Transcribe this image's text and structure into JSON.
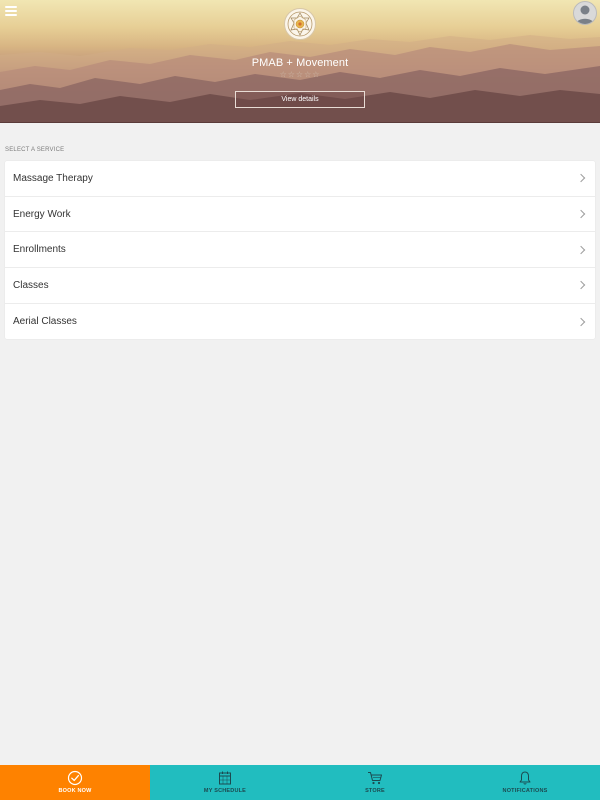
{
  "header": {
    "studio_name": "PMAB + Movement",
    "rating_stars": "☆☆☆☆☆",
    "view_details_label": "View details",
    "menu_icon": "hamburger-menu-icon",
    "avatar_icon": "user-avatar-icon",
    "logo_icon": "mandala-logo-icon"
  },
  "services": {
    "section_label": "SELECT A SERVICE",
    "items": [
      {
        "label": "Massage Therapy"
      },
      {
        "label": "Energy Work"
      },
      {
        "label": "Enrollments"
      },
      {
        "label": "Classes"
      },
      {
        "label": "Aerial Classes"
      }
    ]
  },
  "bottom_nav": {
    "items": [
      {
        "label": "BOOK NOW",
        "icon": "check-circle-icon",
        "active": true
      },
      {
        "label": "MY SCHEDULE",
        "icon": "calendar-icon",
        "active": false
      },
      {
        "label": "STORE",
        "icon": "shopping-cart-icon",
        "active": false
      },
      {
        "label": "NOTIFICATIONS",
        "icon": "bell-icon",
        "active": false
      }
    ]
  },
  "colors": {
    "nav_background": "#21bdbf",
    "nav_active": "#fe8200",
    "page_background": "#f1f1f1"
  }
}
